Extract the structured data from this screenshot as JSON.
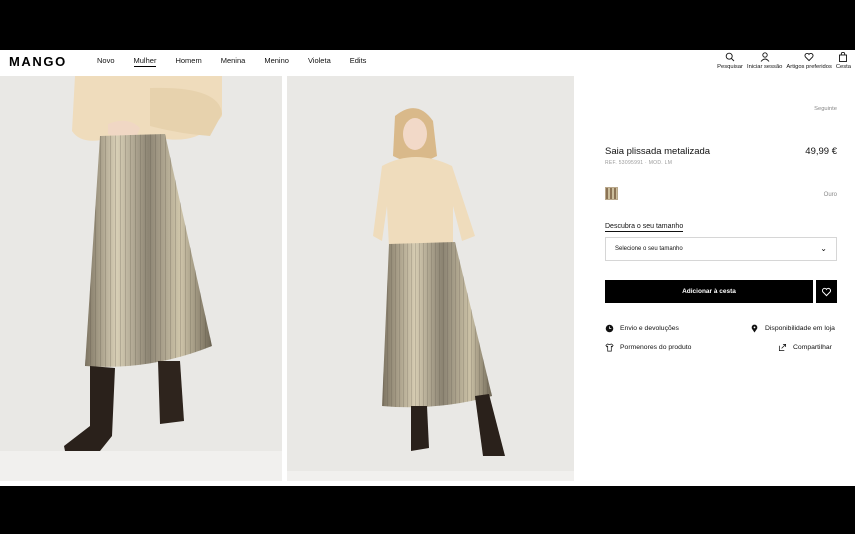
{
  "brand": {
    "logo": "MANGO"
  },
  "nav": {
    "items": [
      {
        "label": "Novo",
        "active": false
      },
      {
        "label": "Mulher",
        "active": true
      },
      {
        "label": "Homem",
        "active": false
      },
      {
        "label": "Menina",
        "active": false
      },
      {
        "label": "Menino",
        "active": false
      },
      {
        "label": "Violeta",
        "active": false
      },
      {
        "label": "Edits",
        "active": false
      }
    ]
  },
  "tools": {
    "search": {
      "label": "Pesquisar",
      "icon": "search-icon"
    },
    "login": {
      "label": "Iniciar sessão",
      "icon": "user-icon"
    },
    "favorites": {
      "label": "Artigos preferidos",
      "icon": "heart-icon"
    },
    "cart": {
      "label": "Cesta",
      "icon": "bag-icon"
    }
  },
  "product": {
    "next_link": "Seguinte",
    "title": "Saia plissada metalizada",
    "price": "49,99 €",
    "reference": "REF. 53095991 · MOD. LM",
    "color_name": "Ouro",
    "size_label": "Descubra o seu tamanho",
    "size_placeholder": "Selecione o seu tamanho",
    "add_to_cart": "Adicionar à cesta"
  },
  "info": {
    "shipping": "Envio e devoluções",
    "store": "Disponibilidade em loja",
    "details": "Pormenores do produto",
    "share": "Compartilhar"
  },
  "colors": {
    "accent": "#000000",
    "background": "#ffffff",
    "photo_bg": "#e8e7e4"
  }
}
